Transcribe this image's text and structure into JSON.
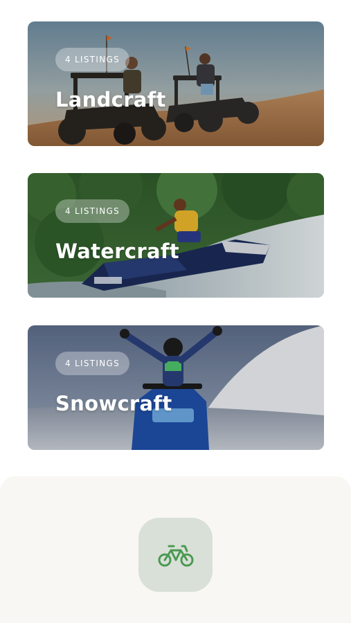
{
  "categories": [
    {
      "id": "landcraft",
      "title": "Landcraft",
      "listings": "4 LISTINGS"
    },
    {
      "id": "watercraft",
      "title": "Watercraft",
      "listings": "4 LISTINGS"
    },
    {
      "id": "snowcraft",
      "title": "Snowcraft",
      "listings": "4 LISTINGS"
    }
  ],
  "bottom_nav": {
    "active_icon": "bicycle-icon",
    "accent_color": "#4a9a52"
  }
}
